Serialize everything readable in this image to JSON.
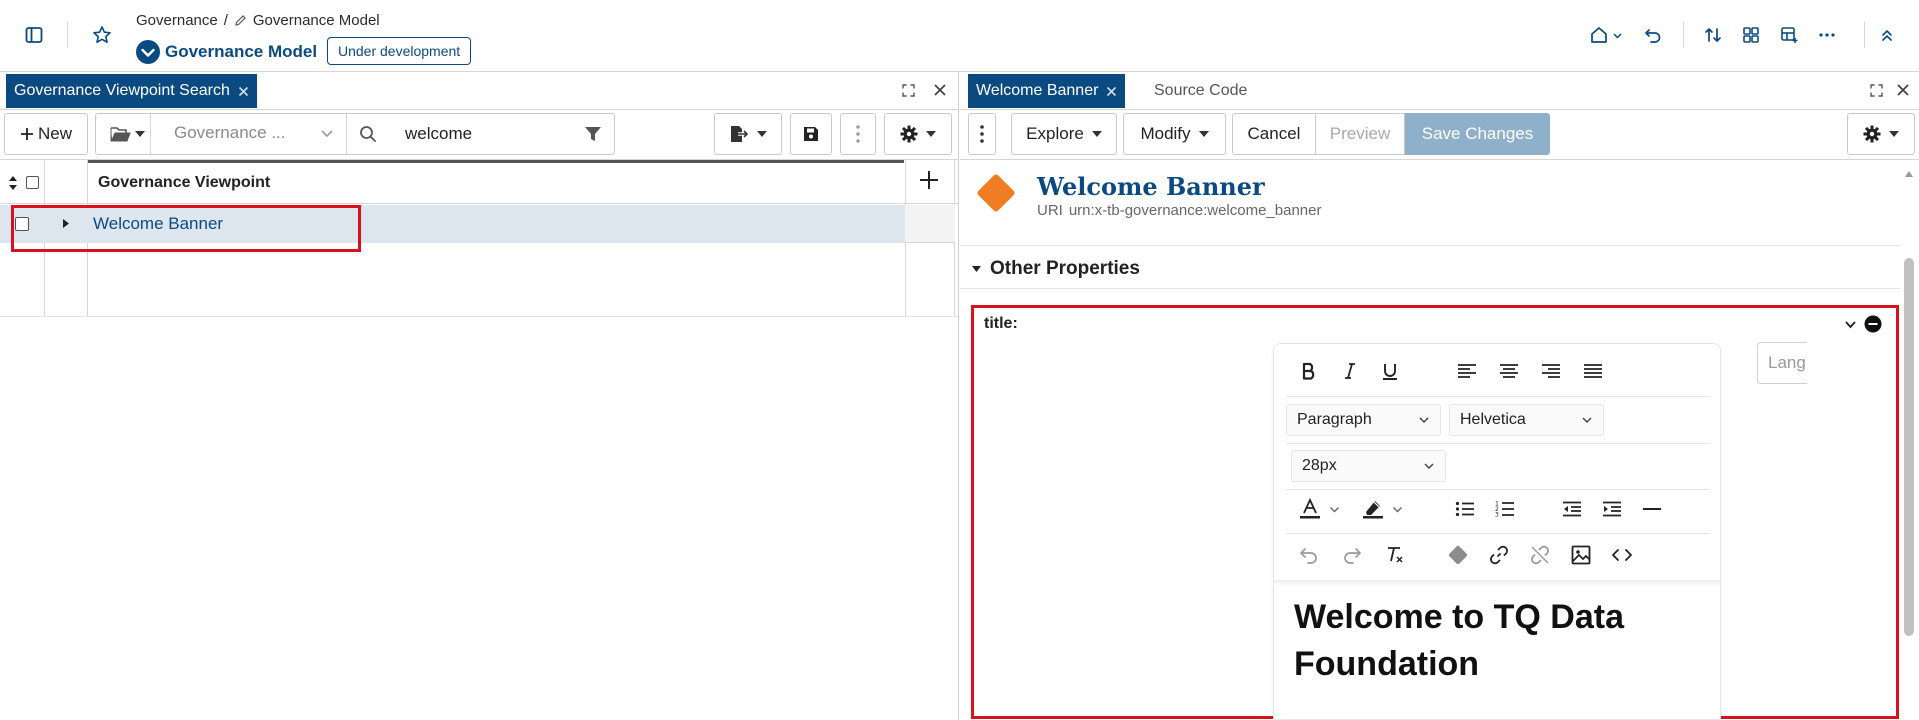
{
  "header": {
    "breadcrumb_root": "Governance",
    "breadcrumb_sep": "/",
    "breadcrumb_current": "Governance Model",
    "page_title": "Governance Model",
    "status": "Under development"
  },
  "left_panel": {
    "tab_label": "Governance Viewpoint Search",
    "toolbar": {
      "new_label": "New",
      "scope_value": "Governance ...",
      "search_value": "welcome",
      "search_placeholder": ""
    },
    "table": {
      "column_header": "Governance Viewpoint",
      "rows": [
        {
          "label": "Welcome Banner",
          "selected": true
        }
      ]
    }
  },
  "right_panel": {
    "tabs": [
      {
        "label": "Welcome Banner",
        "active": true
      },
      {
        "label": "Source Code",
        "active": false
      }
    ],
    "toolbar": {
      "explore_label": "Explore",
      "modify_label": "Modify",
      "cancel_label": "Cancel",
      "preview_label": "Preview",
      "save_label": "Save Changes"
    },
    "resource": {
      "title": "Welcome Banner",
      "uri_label": "URI",
      "uri_value": "urn:x-tb-governance:welcome_banner",
      "icon_color": "#f07d22"
    },
    "section_label": "Other Properties",
    "property": {
      "label": "title:",
      "language_placeholder": "Lang"
    },
    "editor": {
      "block_format": "Paragraph",
      "font_family": "Helvetica",
      "font_size": "28px",
      "content_text": "Welcome to TQ Data Foundation"
    }
  },
  "colors": {
    "brand": "#0b4a80",
    "highlight_box": "#d9111f",
    "selected_row": "#dde6ee",
    "save_disabled": "#8fb0cb"
  },
  "icons": [
    "sidebar-toggle-icon",
    "star-icon",
    "pencil-icon",
    "check-circle-icon",
    "home-icon",
    "undo-icon",
    "sort-icon",
    "grid-icon",
    "add-widget-icon",
    "more-icon",
    "collapse-up-icon",
    "maximize-icon",
    "close-icon",
    "plus-icon",
    "folder-open-icon",
    "chevron-down-icon",
    "search-icon",
    "filter-icon",
    "export-icon",
    "save-icon",
    "kebab-icon",
    "gear-icon",
    "sort-both-icon",
    "caret-right-icon",
    "diamond-icon",
    "minus-circle-icon",
    "bold-icon",
    "italic-icon",
    "underline-icon",
    "align-left-icon",
    "align-center-icon",
    "align-right-icon",
    "align-justify-icon",
    "font-color-icon",
    "highlight-icon",
    "bullet-list-icon",
    "numbered-list-icon",
    "outdent-icon",
    "indent-icon",
    "horizontal-rule-icon",
    "redo-icon",
    "clear-format-icon",
    "anchor-icon",
    "link-icon",
    "unlink-icon",
    "image-icon",
    "code-icon"
  ]
}
